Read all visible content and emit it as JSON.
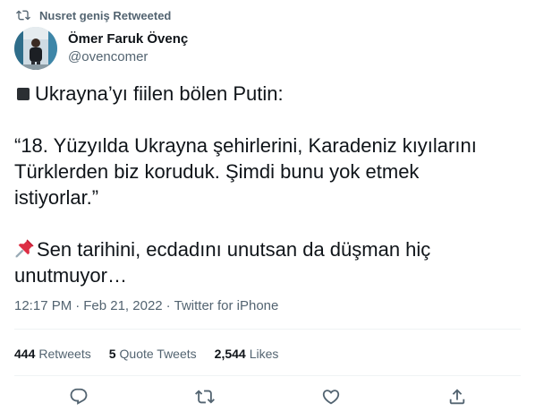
{
  "retweet_context": {
    "text": "Nusret geniş Retweeted",
    "icon": "retweet-icon"
  },
  "author": {
    "display_name": "Ömer Faruk Övenç",
    "handle": "@ovencomer",
    "avatar": "avatar"
  },
  "tweet": {
    "line1": "Ukrayna’yı fiilen bölen Putin:",
    "line1_prefix_icon": "black-small-square-icon",
    "quote_line1": "“18. Yüzyılda Ukrayna şehirlerini, Karadeniz kıyılarını",
    "quote_line2": "Türklerden biz koruduk. Şimdi bunu yok etmek",
    "quote_line3": "istiyorlar.”",
    "closing_icon": "pushpin-icon",
    "closing_line1": "Sen tarihini, ecdadını unutsan da düşman hiç",
    "closing_line2": "unutmuyor…"
  },
  "meta": {
    "time": "12:17 PM",
    "separator": "·",
    "date": "Feb 21, 2022",
    "source": "Twitter for iPhone"
  },
  "stats": {
    "retweets_count": "444",
    "retweets_label": "Retweets",
    "quotes_count": "5",
    "quotes_label": "Quote Tweets",
    "likes_count": "2,544",
    "likes_label": "Likes"
  },
  "actions": [
    "reply-icon",
    "retweet-icon",
    "like-icon",
    "share-icon"
  ],
  "colors": {
    "text_primary": "#0f1419",
    "text_secondary": "#536471",
    "divider": "#eff3f4"
  }
}
